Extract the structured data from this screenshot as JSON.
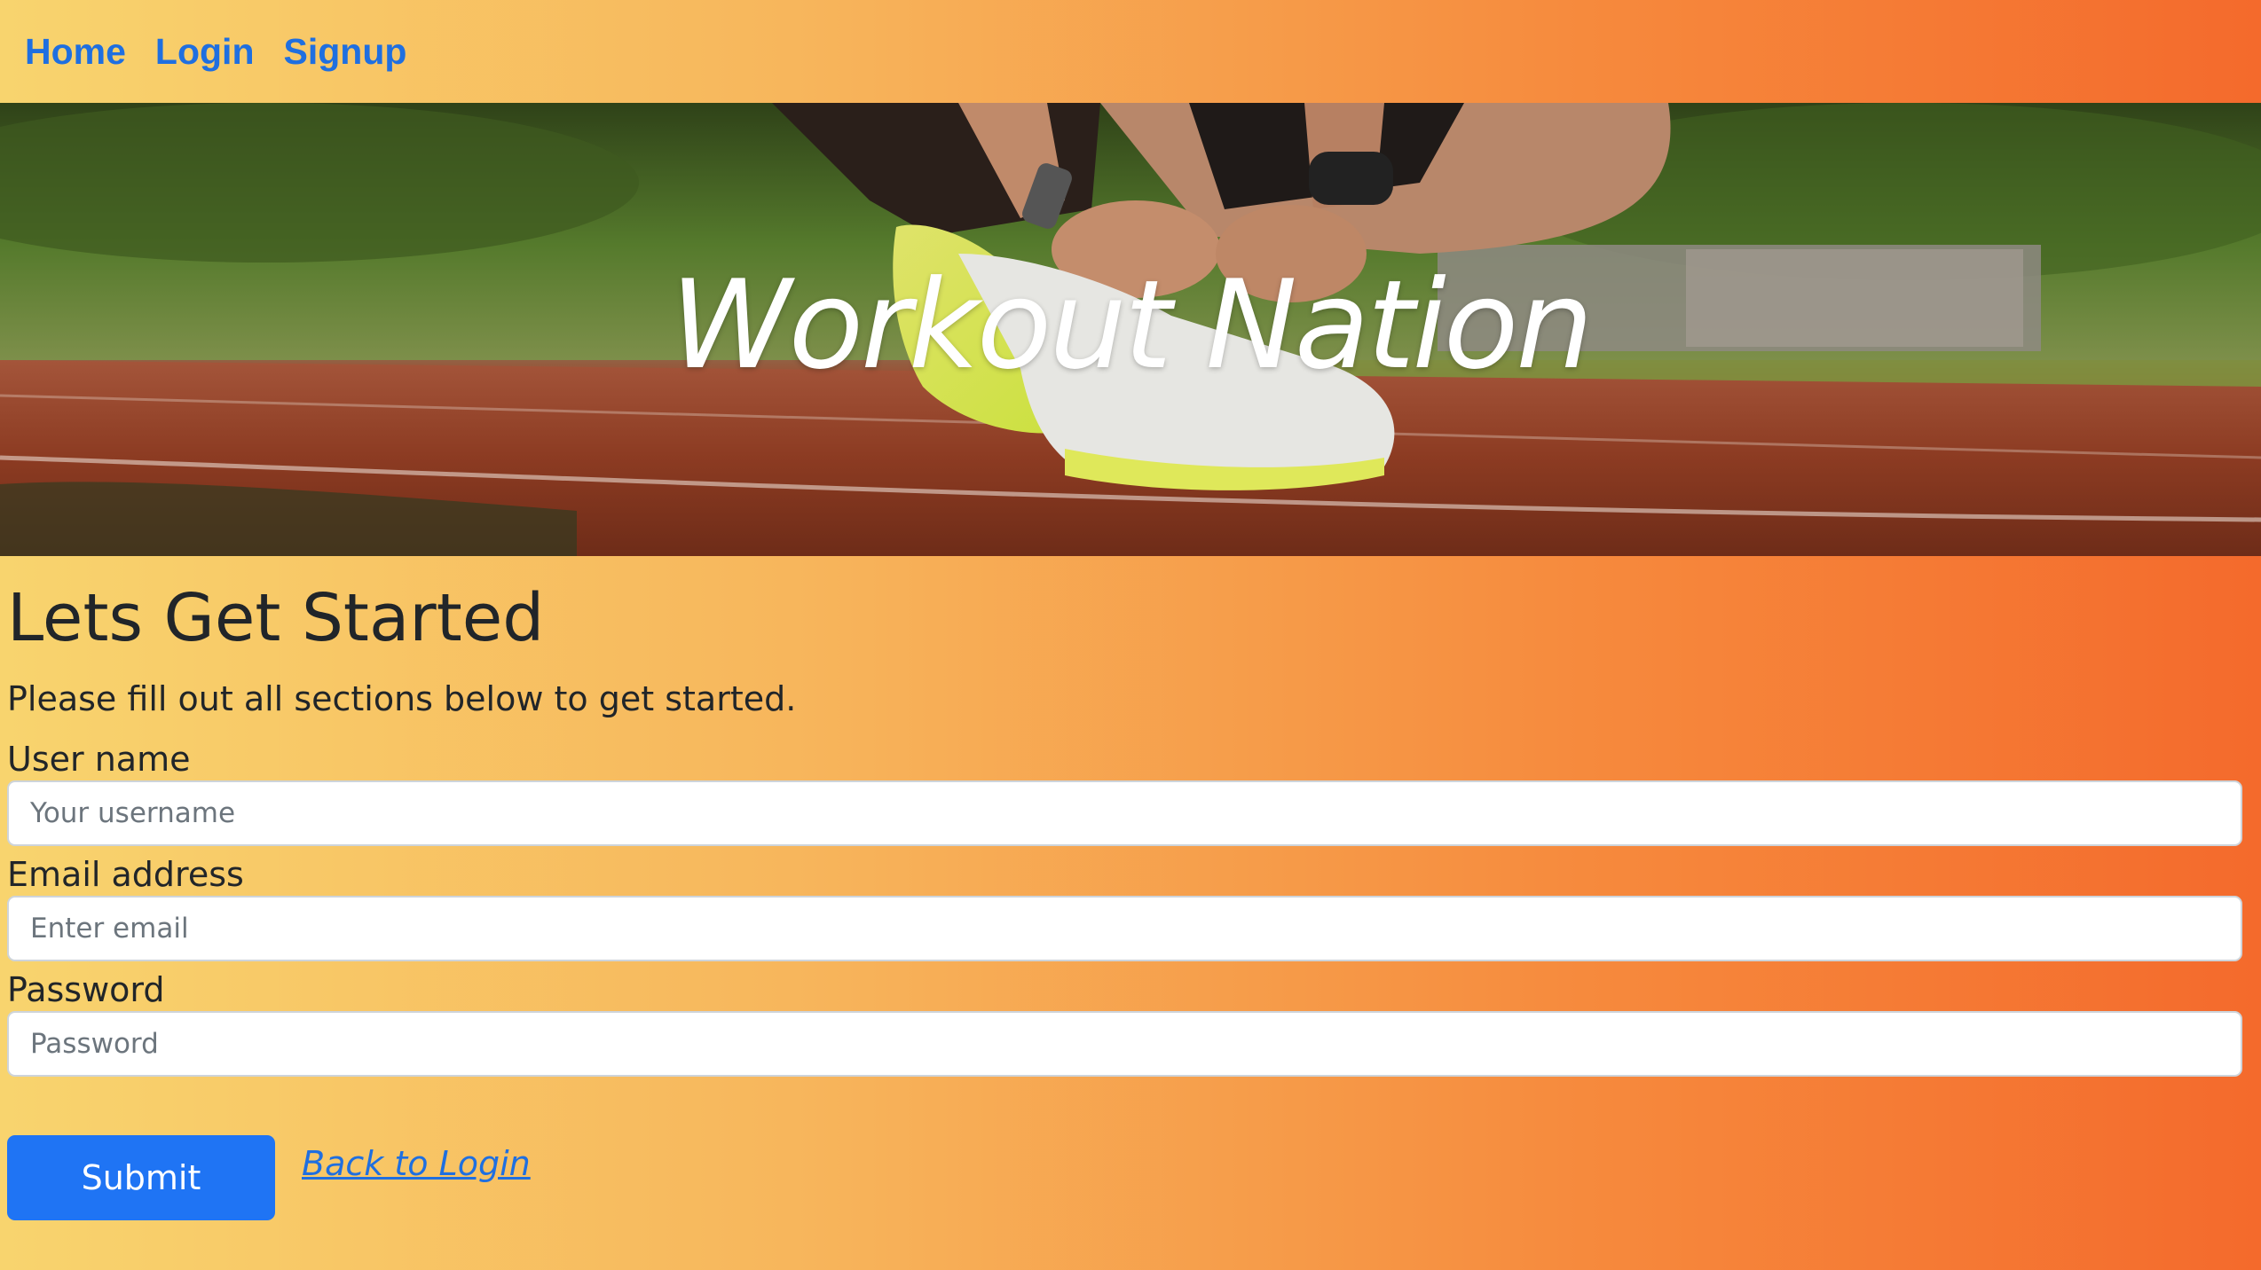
{
  "nav": {
    "items": [
      {
        "label": "Home"
      },
      {
        "label": "Login"
      },
      {
        "label": "Signup"
      }
    ]
  },
  "hero": {
    "title": "Workout Nation",
    "image_subject": "runner lacing yellow running shoes on a red running track"
  },
  "main": {
    "heading": "Lets Get Started",
    "subtitle": "Please fill out all sections below to get started."
  },
  "form": {
    "username": {
      "label": "User name",
      "placeholder": "Your username",
      "value": ""
    },
    "email": {
      "label": "Email address",
      "placeholder": "Enter email",
      "value": ""
    },
    "password": {
      "label": "Password",
      "placeholder": "Password",
      "value": ""
    },
    "submit_label": "Submit",
    "back_link_label": "Back to Login"
  },
  "colors": {
    "link": "#1f6fe0",
    "button": "#1f74f4",
    "gradient_start": "#f8d46e",
    "gradient_end": "#f46a2c"
  }
}
